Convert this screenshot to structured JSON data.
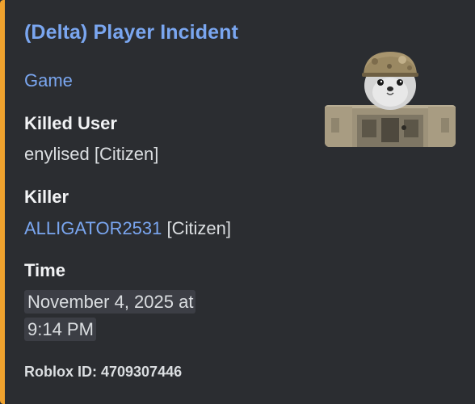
{
  "embed": {
    "accent_color": "#f0a22e",
    "title": "(Delta) Player Incident",
    "link_text": "Game",
    "fields": [
      {
        "name": "Killed User",
        "value": "enylised [Citizen]"
      },
      {
        "name": "Killer",
        "value_link": "ALLIGATOR2531",
        "value_suffix": " [Citizen]"
      },
      {
        "name": "Time",
        "value_line1": "November 4, 2025 at",
        "value_line2": "9:14 PM"
      }
    ],
    "footer": "Roblox ID: 4709307446",
    "thumbnail_icon": "roblox-avatar-seal-helmet"
  }
}
